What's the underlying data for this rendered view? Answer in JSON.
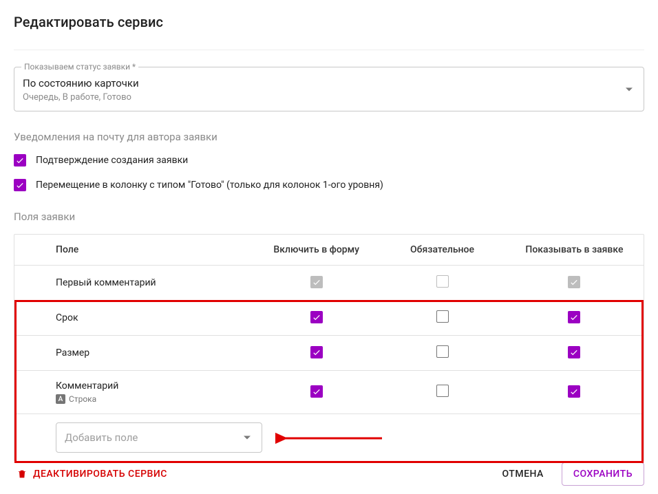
{
  "pageTitle": "Редактировать сервис",
  "statusSelect": {
    "label": "Показываем статус заявки *",
    "value": "По состоянию карточки",
    "hint": "Очередь, В работе, Готово"
  },
  "notifications": {
    "sectionLabel": "Уведомления на почту для автора заявки",
    "items": [
      {
        "label": "Подтверждение создания заявки",
        "checked": true
      },
      {
        "label": "Перемещение в колонку с типом \"Готово\" (только для колонок 1-ого уровня)",
        "checked": true
      }
    ]
  },
  "fields": {
    "sectionLabel": "Поля заявки",
    "columns": {
      "field": "Поле",
      "includeInForm": "Включить в форму",
      "required": "Обязательное",
      "showInRequest": "Показывать в заявке"
    },
    "rows": [
      {
        "label": "Первый комментарий",
        "typeLabel": null,
        "include": {
          "checked": true,
          "disabled": true
        },
        "required": {
          "checked": false,
          "disabled": true
        },
        "show": {
          "checked": true,
          "disabled": true
        }
      },
      {
        "label": "Срок",
        "typeLabel": null,
        "include": {
          "checked": true,
          "disabled": false
        },
        "required": {
          "checked": false,
          "disabled": false
        },
        "show": {
          "checked": true,
          "disabled": false
        }
      },
      {
        "label": "Размер",
        "typeLabel": null,
        "include": {
          "checked": true,
          "disabled": false
        },
        "required": {
          "checked": false,
          "disabled": false
        },
        "show": {
          "checked": true,
          "disabled": false
        }
      },
      {
        "label": "Комментарий",
        "typeLabel": "Строка",
        "typeBadge": "A",
        "include": {
          "checked": true,
          "disabled": false
        },
        "required": {
          "checked": false,
          "disabled": false
        },
        "show": {
          "checked": true,
          "disabled": false
        }
      }
    ],
    "addFieldPlaceholder": "Добавить поле"
  },
  "footer": {
    "deactivate": "ДЕАКТИВИРОВАТЬ СЕРВИС",
    "cancel": "ОТМЕНА",
    "save": "СОХРАНИТЬ"
  },
  "colors": {
    "accent": "#9b00c2",
    "danger": "#d50000",
    "annotation": "#e10000"
  }
}
